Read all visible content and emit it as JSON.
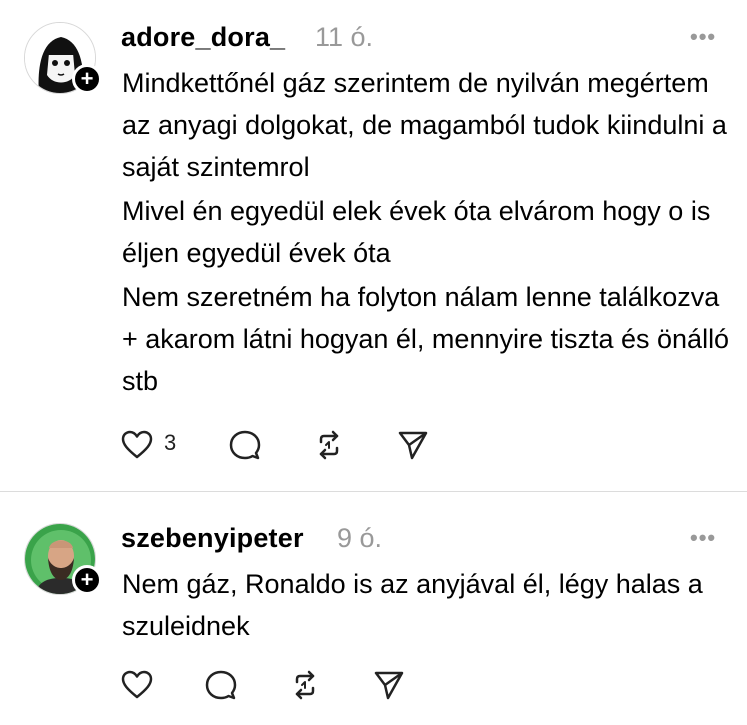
{
  "posts": [
    {
      "username": "adore_dora_",
      "time": "11 ó.",
      "more": "•••",
      "paragraphs": [
        "Mindkettőnél gáz szerintem de nyilván megértem az anyagi dolgokat, de magamból tudok kiindulni a saját szintemrol",
        "Mivel én egyedül elek évek óta elvárom hogy o is éljen egyedül évek óta",
        "Nem szeretném ha folyton nálam lenne találkozva + akarom látni hogyan él, mennyire tiszta és önálló stb"
      ],
      "like_count": "3"
    },
    {
      "username": "szebenyipeter",
      "time": "9 ó.",
      "more": "•••",
      "paragraphs": [
        "Nem gáz, Ronaldo is az anyjával él, légy halas a szuleidnek"
      ]
    }
  ],
  "icons": {
    "like": "heart-icon",
    "reply": "comment-icon",
    "repost": "repost-icon",
    "share": "send-icon",
    "follow": "plus-icon"
  },
  "colors": {
    "text": "#000000",
    "muted": "#999999",
    "divider": "#dcdcdc"
  }
}
